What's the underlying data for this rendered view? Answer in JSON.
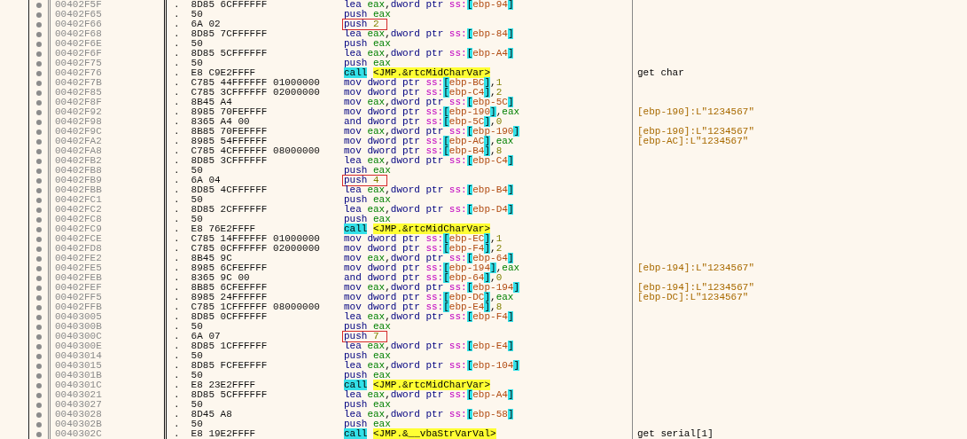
{
  "disassembly": {
    "rows": [
      {
        "address": "00402F5F",
        "flag": ".",
        "bytes": "8D85 6CFFFFFF",
        "marked": false,
        "asm": [
          {
            "kind": "op",
            "text": "lea"
          },
          {
            "kind": "reg",
            "text": "eax"
          },
          {
            "kind": "comma",
            "text": ","
          },
          {
            "kind": "size",
            "text": "dword ptr"
          },
          {
            "kind": "seg",
            "text": "ss:"
          },
          {
            "kind": "br",
            "text": "["
          },
          {
            "kind": "mem",
            "text": "ebp-94"
          },
          {
            "kind": "br",
            "text": "]"
          }
        ]
      },
      {
        "address": "00402F65",
        "flag": ".",
        "bytes": "50",
        "marked": false,
        "asm": [
          {
            "kind": "op",
            "text": "push"
          },
          {
            "kind": "reg",
            "text": "eax"
          }
        ]
      },
      {
        "address": "00402F66",
        "flag": ".",
        "bytes": "6A 02",
        "marked": true,
        "asm": [
          {
            "kind": "op",
            "text": "push"
          },
          {
            "kind": "num",
            "text": "2"
          }
        ]
      },
      {
        "address": "00402F68",
        "flag": ".",
        "bytes": "8D85 7CFFFFFF",
        "marked": false,
        "asm": [
          {
            "kind": "op",
            "text": "lea"
          },
          {
            "kind": "reg",
            "text": "eax"
          },
          {
            "kind": "comma",
            "text": ","
          },
          {
            "kind": "size",
            "text": "dword ptr"
          },
          {
            "kind": "seg",
            "text": "ss:"
          },
          {
            "kind": "br",
            "text": "["
          },
          {
            "kind": "mem",
            "text": "ebp-84"
          },
          {
            "kind": "br",
            "text": "]"
          }
        ]
      },
      {
        "address": "00402F6E",
        "flag": ".",
        "bytes": "50",
        "marked": false,
        "asm": [
          {
            "kind": "op",
            "text": "push"
          },
          {
            "kind": "reg",
            "text": "eax"
          }
        ]
      },
      {
        "address": "00402F6F",
        "flag": ".",
        "bytes": "8D85 5CFFFFFF",
        "marked": false,
        "asm": [
          {
            "kind": "op",
            "text": "lea"
          },
          {
            "kind": "reg",
            "text": "eax"
          },
          {
            "kind": "comma",
            "text": ","
          },
          {
            "kind": "size",
            "text": "dword ptr"
          },
          {
            "kind": "seg",
            "text": "ss:"
          },
          {
            "kind": "br",
            "text": "["
          },
          {
            "kind": "mem",
            "text": "ebp-A4"
          },
          {
            "kind": "br",
            "text": "]"
          }
        ]
      },
      {
        "address": "00402F75",
        "flag": ".",
        "bytes": "50",
        "marked": false,
        "asm": [
          {
            "kind": "op",
            "text": "push"
          },
          {
            "kind": "reg",
            "text": "eax"
          }
        ]
      },
      {
        "address": "00402F76",
        "flag": ".",
        "bytes": "E8 C9E2FFFF",
        "marked": false,
        "asm": [
          {
            "kind": "call",
            "text": "call"
          },
          {
            "kind": "target",
            "text": "<JMP.&rtcMidCharVar>"
          }
        ],
        "comment": {
          "kind": "label",
          "text": "get char"
        }
      },
      {
        "address": "00402F7B",
        "flag": ".",
        "bytes": "C785 44FFFFFF 01000000",
        "marked": false,
        "asm": [
          {
            "kind": "op",
            "text": "mov"
          },
          {
            "kind": "size",
            "text": "dword ptr"
          },
          {
            "kind": "seg",
            "text": "ss:"
          },
          {
            "kind": "br",
            "text": "["
          },
          {
            "kind": "mem",
            "text": "ebp-BC"
          },
          {
            "kind": "br",
            "text": "]"
          },
          {
            "kind": "comma",
            "text": ","
          },
          {
            "kind": "num",
            "text": "1"
          }
        ]
      },
      {
        "address": "00402F85",
        "flag": ".",
        "bytes": "C785 3CFFFFFF 02000000",
        "marked": false,
        "asm": [
          {
            "kind": "op",
            "text": "mov"
          },
          {
            "kind": "size",
            "text": "dword ptr"
          },
          {
            "kind": "seg",
            "text": "ss:"
          },
          {
            "kind": "br",
            "text": "["
          },
          {
            "kind": "mem",
            "text": "ebp-C4"
          },
          {
            "kind": "br",
            "text": "]"
          },
          {
            "kind": "comma",
            "text": ","
          },
          {
            "kind": "num",
            "text": "2"
          }
        ]
      },
      {
        "address": "00402F8F",
        "flag": ".",
        "bytes": "8B45 A4",
        "marked": false,
        "asm": [
          {
            "kind": "op",
            "text": "mov"
          },
          {
            "kind": "reg",
            "text": "eax"
          },
          {
            "kind": "comma",
            "text": ","
          },
          {
            "kind": "size",
            "text": "dword ptr"
          },
          {
            "kind": "seg",
            "text": "ss:"
          },
          {
            "kind": "br",
            "text": "["
          },
          {
            "kind": "mem",
            "text": "ebp-5C"
          },
          {
            "kind": "br",
            "text": "]"
          }
        ]
      },
      {
        "address": "00402F92",
        "flag": ".",
        "bytes": "8985 70FEFFFF",
        "marked": false,
        "asm": [
          {
            "kind": "op",
            "text": "mov"
          },
          {
            "kind": "size",
            "text": "dword ptr"
          },
          {
            "kind": "seg",
            "text": "ss:"
          },
          {
            "kind": "br",
            "text": "["
          },
          {
            "kind": "mem",
            "text": "ebp-190"
          },
          {
            "kind": "br",
            "text": "]"
          },
          {
            "kind": "comma",
            "text": ","
          },
          {
            "kind": "reg",
            "text": "eax"
          }
        ],
        "comment": {
          "kind": "value",
          "text": "[ebp-190]:L\"1234567\""
        }
      },
      {
        "address": "00402F98",
        "flag": ".",
        "bytes": "8365 A4 00",
        "marked": false,
        "asm": [
          {
            "kind": "op",
            "text": "and"
          },
          {
            "kind": "size",
            "text": "dword ptr"
          },
          {
            "kind": "seg",
            "text": "ss:"
          },
          {
            "kind": "br",
            "text": "["
          },
          {
            "kind": "mem",
            "text": "ebp-5C"
          },
          {
            "kind": "br",
            "text": "]"
          },
          {
            "kind": "comma",
            "text": ","
          },
          {
            "kind": "num",
            "text": "0"
          }
        ]
      },
      {
        "address": "00402F9C",
        "flag": ".",
        "bytes": "8B85 70FEFFFF",
        "marked": false,
        "asm": [
          {
            "kind": "op",
            "text": "mov"
          },
          {
            "kind": "reg",
            "text": "eax"
          },
          {
            "kind": "comma",
            "text": ","
          },
          {
            "kind": "size",
            "text": "dword ptr"
          },
          {
            "kind": "seg",
            "text": "ss:"
          },
          {
            "kind": "br",
            "text": "["
          },
          {
            "kind": "mem",
            "text": "ebp-190"
          },
          {
            "kind": "br",
            "text": "]"
          }
        ],
        "comment": {
          "kind": "value",
          "text": "[ebp-190]:L\"1234567\""
        }
      },
      {
        "address": "00402FA2",
        "flag": ".",
        "bytes": "8985 54FFFFFF",
        "marked": false,
        "asm": [
          {
            "kind": "op",
            "text": "mov"
          },
          {
            "kind": "size",
            "text": "dword ptr"
          },
          {
            "kind": "seg",
            "text": "ss:"
          },
          {
            "kind": "br",
            "text": "["
          },
          {
            "kind": "mem",
            "text": "ebp-AC"
          },
          {
            "kind": "br",
            "text": "]"
          },
          {
            "kind": "comma",
            "text": ","
          },
          {
            "kind": "reg",
            "text": "eax"
          }
        ],
        "comment": {
          "kind": "value",
          "text": "[ebp-AC]:L\"1234567\""
        }
      },
      {
        "address": "00402FA8",
        "flag": ".",
        "bytes": "C785 4CFFFFFF 08000000",
        "marked": false,
        "asm": [
          {
            "kind": "op",
            "text": "mov"
          },
          {
            "kind": "size",
            "text": "dword ptr"
          },
          {
            "kind": "seg",
            "text": "ss:"
          },
          {
            "kind": "br",
            "text": "["
          },
          {
            "kind": "mem",
            "text": "ebp-B4"
          },
          {
            "kind": "br",
            "text": "]"
          },
          {
            "kind": "comma",
            "text": ","
          },
          {
            "kind": "num",
            "text": "8"
          }
        ]
      },
      {
        "address": "00402FB2",
        "flag": ".",
        "bytes": "8D85 3CFFFFFF",
        "marked": false,
        "asm": [
          {
            "kind": "op",
            "text": "lea"
          },
          {
            "kind": "reg",
            "text": "eax"
          },
          {
            "kind": "comma",
            "text": ","
          },
          {
            "kind": "size",
            "text": "dword ptr"
          },
          {
            "kind": "seg",
            "text": "ss:"
          },
          {
            "kind": "br",
            "text": "["
          },
          {
            "kind": "mem",
            "text": "ebp-C4"
          },
          {
            "kind": "br",
            "text": "]"
          }
        ]
      },
      {
        "address": "00402FB8",
        "flag": ".",
        "bytes": "50",
        "marked": false,
        "asm": [
          {
            "kind": "op",
            "text": "push"
          },
          {
            "kind": "reg",
            "text": "eax"
          }
        ]
      },
      {
        "address": "00402FB9",
        "flag": ".",
        "bytes": "6A 04",
        "marked": true,
        "asm": [
          {
            "kind": "op",
            "text": "push"
          },
          {
            "kind": "num",
            "text": "4"
          }
        ]
      },
      {
        "address": "00402FBB",
        "flag": ".",
        "bytes": "8D85 4CFFFFFF",
        "marked": false,
        "asm": [
          {
            "kind": "op",
            "text": "lea"
          },
          {
            "kind": "reg",
            "text": "eax"
          },
          {
            "kind": "comma",
            "text": ","
          },
          {
            "kind": "size",
            "text": "dword ptr"
          },
          {
            "kind": "seg",
            "text": "ss:"
          },
          {
            "kind": "br",
            "text": "["
          },
          {
            "kind": "mem",
            "text": "ebp-B4"
          },
          {
            "kind": "br",
            "text": "]"
          }
        ]
      },
      {
        "address": "00402FC1",
        "flag": ".",
        "bytes": "50",
        "marked": false,
        "asm": [
          {
            "kind": "op",
            "text": "push"
          },
          {
            "kind": "reg",
            "text": "eax"
          }
        ]
      },
      {
        "address": "00402FC2",
        "flag": ".",
        "bytes": "8D85 2CFFFFFF",
        "marked": false,
        "asm": [
          {
            "kind": "op",
            "text": "lea"
          },
          {
            "kind": "reg",
            "text": "eax"
          },
          {
            "kind": "comma",
            "text": ","
          },
          {
            "kind": "size",
            "text": "dword ptr"
          },
          {
            "kind": "seg",
            "text": "ss:"
          },
          {
            "kind": "br",
            "text": "["
          },
          {
            "kind": "mem",
            "text": "ebp-D4"
          },
          {
            "kind": "br",
            "text": "]"
          }
        ]
      },
      {
        "address": "00402FC8",
        "flag": ".",
        "bytes": "50",
        "marked": false,
        "asm": [
          {
            "kind": "op",
            "text": "push"
          },
          {
            "kind": "reg",
            "text": "eax"
          }
        ]
      },
      {
        "address": "00402FC9",
        "flag": ".",
        "bytes": "E8 76E2FFFF",
        "marked": false,
        "asm": [
          {
            "kind": "call",
            "text": "call"
          },
          {
            "kind": "target",
            "text": "<JMP.&rtcMidCharVar>"
          }
        ]
      },
      {
        "address": "00402FCE",
        "flag": ".",
        "bytes": "C785 14FFFFFF 01000000",
        "marked": false,
        "asm": [
          {
            "kind": "op",
            "text": "mov"
          },
          {
            "kind": "size",
            "text": "dword ptr"
          },
          {
            "kind": "seg",
            "text": "ss:"
          },
          {
            "kind": "br",
            "text": "["
          },
          {
            "kind": "mem",
            "text": "ebp-EC"
          },
          {
            "kind": "br",
            "text": "]"
          },
          {
            "kind": "comma",
            "text": ","
          },
          {
            "kind": "num",
            "text": "1"
          }
        ]
      },
      {
        "address": "00402FD8",
        "flag": ".",
        "bytes": "C785 0CFFFFFF 02000000",
        "marked": false,
        "asm": [
          {
            "kind": "op",
            "text": "mov"
          },
          {
            "kind": "size",
            "text": "dword ptr"
          },
          {
            "kind": "seg",
            "text": "ss:"
          },
          {
            "kind": "br",
            "text": "["
          },
          {
            "kind": "mem",
            "text": "ebp-F4"
          },
          {
            "kind": "br",
            "text": "]"
          },
          {
            "kind": "comma",
            "text": ","
          },
          {
            "kind": "num",
            "text": "2"
          }
        ]
      },
      {
        "address": "00402FE2",
        "flag": ".",
        "bytes": "8B45 9C",
        "marked": false,
        "asm": [
          {
            "kind": "op",
            "text": "mov"
          },
          {
            "kind": "reg",
            "text": "eax"
          },
          {
            "kind": "comma",
            "text": ","
          },
          {
            "kind": "size",
            "text": "dword ptr"
          },
          {
            "kind": "seg",
            "text": "ss:"
          },
          {
            "kind": "br",
            "text": "["
          },
          {
            "kind": "mem",
            "text": "ebp-64"
          },
          {
            "kind": "br",
            "text": "]"
          }
        ]
      },
      {
        "address": "00402FE5",
        "flag": ".",
        "bytes": "8985 6CFEFFFF",
        "marked": false,
        "asm": [
          {
            "kind": "op",
            "text": "mov"
          },
          {
            "kind": "size",
            "text": "dword ptr"
          },
          {
            "kind": "seg",
            "text": "ss:"
          },
          {
            "kind": "br",
            "text": "["
          },
          {
            "kind": "mem",
            "text": "ebp-194"
          },
          {
            "kind": "br",
            "text": "]"
          },
          {
            "kind": "comma",
            "text": ","
          },
          {
            "kind": "reg",
            "text": "eax"
          }
        ],
        "comment": {
          "kind": "value",
          "text": "[ebp-194]:L\"1234567\""
        }
      },
      {
        "address": "00402FEB",
        "flag": ".",
        "bytes": "8365 9C 00",
        "marked": false,
        "asm": [
          {
            "kind": "op",
            "text": "and"
          },
          {
            "kind": "size",
            "text": "dword ptr"
          },
          {
            "kind": "seg",
            "text": "ss:"
          },
          {
            "kind": "br",
            "text": "["
          },
          {
            "kind": "mem",
            "text": "ebp-64"
          },
          {
            "kind": "br",
            "text": "]"
          },
          {
            "kind": "comma",
            "text": ","
          },
          {
            "kind": "num",
            "text": "0"
          }
        ]
      },
      {
        "address": "00402FEF",
        "flag": ".",
        "bytes": "8B85 6CFEFFFF",
        "marked": false,
        "asm": [
          {
            "kind": "op",
            "text": "mov"
          },
          {
            "kind": "reg",
            "text": "eax"
          },
          {
            "kind": "comma",
            "text": ","
          },
          {
            "kind": "size",
            "text": "dword ptr"
          },
          {
            "kind": "seg",
            "text": "ss:"
          },
          {
            "kind": "br",
            "text": "["
          },
          {
            "kind": "mem",
            "text": "ebp-194"
          },
          {
            "kind": "br",
            "text": "]"
          }
        ],
        "comment": {
          "kind": "value",
          "text": "[ebp-194]:L\"1234567\""
        }
      },
      {
        "address": "00402FF5",
        "flag": ".",
        "bytes": "8985 24FFFFFF",
        "marked": false,
        "asm": [
          {
            "kind": "op",
            "text": "mov"
          },
          {
            "kind": "size",
            "text": "dword ptr"
          },
          {
            "kind": "seg",
            "text": "ss:"
          },
          {
            "kind": "br",
            "text": "["
          },
          {
            "kind": "mem",
            "text": "ebp-DC"
          },
          {
            "kind": "br",
            "text": "]"
          },
          {
            "kind": "comma",
            "text": ","
          },
          {
            "kind": "reg",
            "text": "eax"
          }
        ],
        "comment": {
          "kind": "value",
          "text": "[ebp-DC]:L\"1234567\""
        }
      },
      {
        "address": "00402FFB",
        "flag": ".",
        "bytes": "C785 1CFFFFFF 08000000",
        "marked": false,
        "asm": [
          {
            "kind": "op",
            "text": "mov"
          },
          {
            "kind": "size",
            "text": "dword ptr"
          },
          {
            "kind": "seg",
            "text": "ss:"
          },
          {
            "kind": "br",
            "text": "["
          },
          {
            "kind": "mem",
            "text": "ebp-E4"
          },
          {
            "kind": "br",
            "text": "]"
          },
          {
            "kind": "comma",
            "text": ","
          },
          {
            "kind": "num",
            "text": "8"
          }
        ]
      },
      {
        "address": "00403005",
        "flag": ".",
        "bytes": "8D85 0CFFFFFF",
        "marked": false,
        "asm": [
          {
            "kind": "op",
            "text": "lea"
          },
          {
            "kind": "reg",
            "text": "eax"
          },
          {
            "kind": "comma",
            "text": ","
          },
          {
            "kind": "size",
            "text": "dword ptr"
          },
          {
            "kind": "seg",
            "text": "ss:"
          },
          {
            "kind": "br",
            "text": "["
          },
          {
            "kind": "mem",
            "text": "ebp-F4"
          },
          {
            "kind": "br",
            "text": "]"
          }
        ]
      },
      {
        "address": "0040300B",
        "flag": ".",
        "bytes": "50",
        "marked": false,
        "asm": [
          {
            "kind": "op",
            "text": "push"
          },
          {
            "kind": "reg",
            "text": "eax"
          }
        ]
      },
      {
        "address": "0040300C",
        "flag": ".",
        "bytes": "6A 07",
        "marked": true,
        "asm": [
          {
            "kind": "op",
            "text": "push"
          },
          {
            "kind": "num",
            "text": "7"
          }
        ]
      },
      {
        "address": "0040300E",
        "flag": ".",
        "bytes": "8D85 1CFFFFFF",
        "marked": false,
        "asm": [
          {
            "kind": "op",
            "text": "lea"
          },
          {
            "kind": "reg",
            "text": "eax"
          },
          {
            "kind": "comma",
            "text": ","
          },
          {
            "kind": "size",
            "text": "dword ptr"
          },
          {
            "kind": "seg",
            "text": "ss:"
          },
          {
            "kind": "br",
            "text": "["
          },
          {
            "kind": "mem",
            "text": "ebp-E4"
          },
          {
            "kind": "br",
            "text": "]"
          }
        ]
      },
      {
        "address": "00403014",
        "flag": ".",
        "bytes": "50",
        "marked": false,
        "asm": [
          {
            "kind": "op",
            "text": "push"
          },
          {
            "kind": "reg",
            "text": "eax"
          }
        ]
      },
      {
        "address": "00403015",
        "flag": ".",
        "bytes": "8D85 FCFEFFFF",
        "marked": false,
        "asm": [
          {
            "kind": "op",
            "text": "lea"
          },
          {
            "kind": "reg",
            "text": "eax"
          },
          {
            "kind": "comma",
            "text": ","
          },
          {
            "kind": "size",
            "text": "dword ptr"
          },
          {
            "kind": "seg",
            "text": "ss:"
          },
          {
            "kind": "br",
            "text": "["
          },
          {
            "kind": "mem",
            "text": "ebp-104"
          },
          {
            "kind": "br",
            "text": "]"
          }
        ]
      },
      {
        "address": "0040301B",
        "flag": ".",
        "bytes": "50",
        "marked": false,
        "asm": [
          {
            "kind": "op",
            "text": "push"
          },
          {
            "kind": "reg",
            "text": "eax"
          }
        ]
      },
      {
        "address": "0040301C",
        "flag": ".",
        "bytes": "E8 23E2FFFF",
        "marked": false,
        "asm": [
          {
            "kind": "call",
            "text": "call"
          },
          {
            "kind": "target",
            "text": "<JMP.&rtcMidCharVar>"
          }
        ]
      },
      {
        "address": "00403021",
        "flag": ".",
        "bytes": "8D85 5CFFFFFF",
        "marked": false,
        "asm": [
          {
            "kind": "op",
            "text": "lea"
          },
          {
            "kind": "reg",
            "text": "eax"
          },
          {
            "kind": "comma",
            "text": ","
          },
          {
            "kind": "size",
            "text": "dword ptr"
          },
          {
            "kind": "seg",
            "text": "ss:"
          },
          {
            "kind": "br",
            "text": "["
          },
          {
            "kind": "mem",
            "text": "ebp-A4"
          },
          {
            "kind": "br",
            "text": "]"
          }
        ]
      },
      {
        "address": "00403027",
        "flag": ".",
        "bytes": "50",
        "marked": false,
        "asm": [
          {
            "kind": "op",
            "text": "push"
          },
          {
            "kind": "reg",
            "text": "eax"
          }
        ]
      },
      {
        "address": "00403028",
        "flag": ".",
        "bytes": "8D45 A8",
        "marked": false,
        "asm": [
          {
            "kind": "op",
            "text": "lea"
          },
          {
            "kind": "reg",
            "text": "eax"
          },
          {
            "kind": "comma",
            "text": ","
          },
          {
            "kind": "size",
            "text": "dword ptr"
          },
          {
            "kind": "seg",
            "text": "ss:"
          },
          {
            "kind": "br",
            "text": "["
          },
          {
            "kind": "mem",
            "text": "ebp-58"
          },
          {
            "kind": "br",
            "text": "]"
          }
        ]
      },
      {
        "address": "0040302B",
        "flag": ".",
        "bytes": "50",
        "marked": false,
        "asm": [
          {
            "kind": "op",
            "text": "push"
          },
          {
            "kind": "reg",
            "text": "eax"
          }
        ]
      },
      {
        "address": "0040302C",
        "flag": ".",
        "bytes": "E8 19E2FFFF",
        "marked": false,
        "asm": [
          {
            "kind": "call",
            "text": "call"
          },
          {
            "kind": "target",
            "text": "<JMP.&__vbaStrVarVal>"
          }
        ],
        "comment": {
          "kind": "label",
          "text": "get serial[1]"
        }
      }
    ]
  }
}
